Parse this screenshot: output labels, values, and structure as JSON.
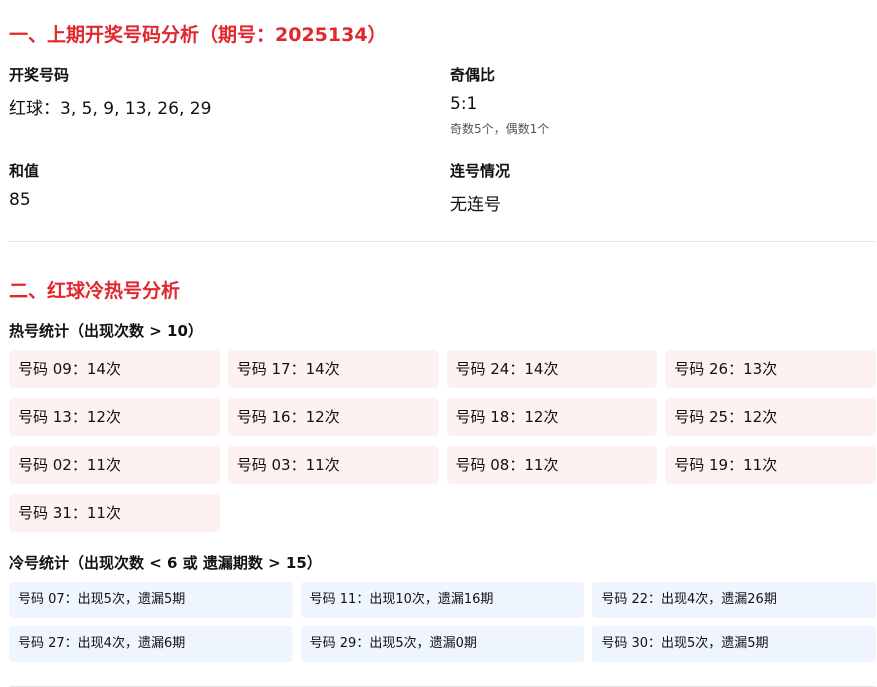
{
  "section1": {
    "title": "一、上期开奖号码分析（期号：2025134）",
    "numbers_label": "开奖号码",
    "numbers_value": "红球：3, 5, 9, 13, 26, 29",
    "odd_even_label": "奇偶比",
    "odd_even_value": "5:1",
    "odd_even_note": "奇数5个，偶数1个",
    "sum_label": "和值",
    "sum_value": "85",
    "consecutive_label": "连号情况",
    "consecutive_value": "无连号"
  },
  "section2": {
    "title": "二、红球冷热号分析",
    "hot_title": "热号统计（出现次数 > 10）",
    "hot": [
      "号码 09：14次",
      "号码 17：14次",
      "号码 24：14次",
      "号码 26：13次",
      "号码 13：12次",
      "号码 16：12次",
      "号码 18：12次",
      "号码 25：12次",
      "号码 02：11次",
      "号码 03：11次",
      "号码 08：11次",
      "号码 19：11次",
      "号码 31：11次"
    ],
    "cold_title": "冷号统计（出现次数 < 6 或 遗漏期数 > 15）",
    "cold": [
      "号码 07：出现5次，遗漏5期",
      "号码 11：出现10次，遗漏16期",
      "号码 22：出现4次，遗漏26期",
      "号码 27：出现4次，遗漏6期",
      "号码 29：出现5次，遗漏0期",
      "号码 30：出现5次，遗漏5期"
    ]
  }
}
